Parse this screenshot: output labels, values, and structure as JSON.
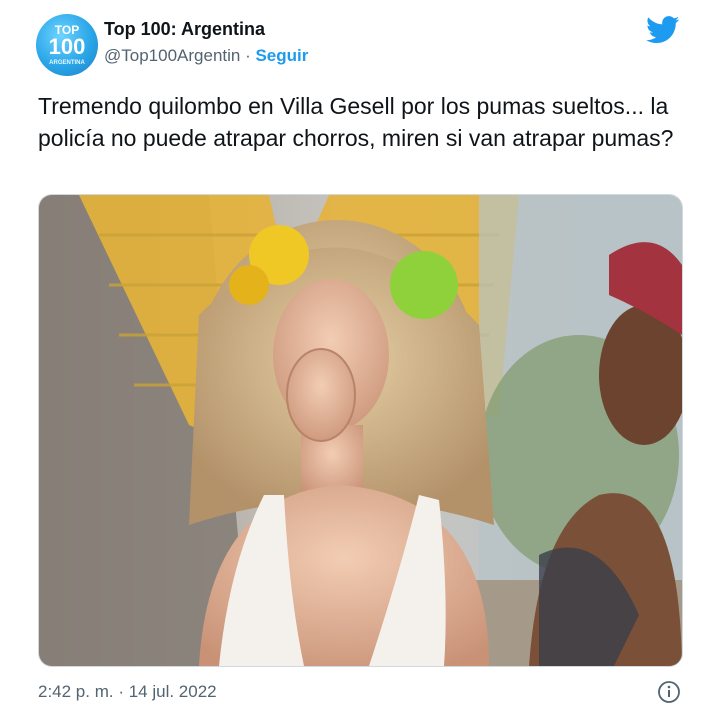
{
  "account": {
    "display_name": "Top 100: Argentina",
    "handle": "@Top100Argentin",
    "separator": " · ",
    "follow_label": "Seguir",
    "avatar_text_top": "TOP",
    "avatar_text_number": "100",
    "avatar_text_bottom": "ARGENTINA"
  },
  "tweet": {
    "text": "Tremendo quilombo en Villa Gesell por los pumas sueltos... la policía no puede atrapar chorros, miren si van atrapar pumas?",
    "timestamp": "2:42 p. m. · 14 jul. 2022"
  },
  "icons": {
    "brand": "twitter-bird-icon",
    "info": "info-icon"
  },
  "colors": {
    "accent": "#1d9bf0",
    "secondary_text": "#536471",
    "primary_text": "#0f1419",
    "border": "#cfd9de"
  }
}
